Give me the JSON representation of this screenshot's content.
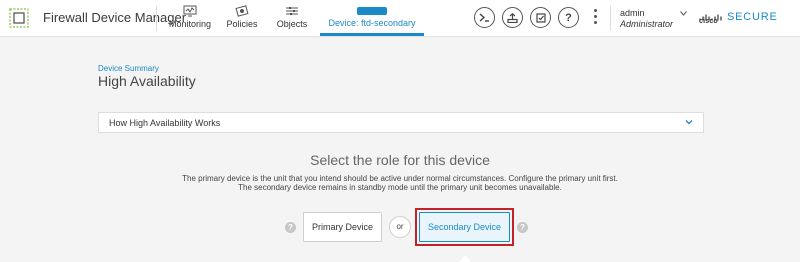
{
  "app": {
    "title": "Firewall Device Manager",
    "brand_word": "cisco",
    "brand_product": "SECURE"
  },
  "nav": {
    "items": [
      {
        "label": "Monitoring",
        "icon": "monitoring-icon"
      },
      {
        "label": "Policies",
        "icon": "policies-icon"
      },
      {
        "label": "Objects",
        "icon": "objects-icon"
      },
      {
        "label": "Device: ftd-secondary",
        "icon": "device-icon",
        "active": true
      }
    ]
  },
  "header_icons": [
    "cli-console-icon",
    "deploy-icon",
    "api-explorer-icon",
    "help-icon",
    "more-options-icon"
  ],
  "user": {
    "name": "admin",
    "role": "Administrator"
  },
  "breadcrumb": "Device Summary",
  "page_title": "High Availability",
  "accordion": {
    "label": "How High Availability Works"
  },
  "role_section": {
    "title": "Select the role for this device",
    "description_line1": "The primary device is the unit that you intend should be active under normal circumstances. Configure the primary unit first.",
    "description_line2": "The secondary device remains in standby mode until the primary unit becomes unavailable.",
    "primary_label": "Primary Device",
    "or_label": "or",
    "secondary_label": "Secondary Device",
    "help_glyph": "?"
  },
  "colors": {
    "accent": "#1a8bc8",
    "highlight": "#c1232b"
  }
}
